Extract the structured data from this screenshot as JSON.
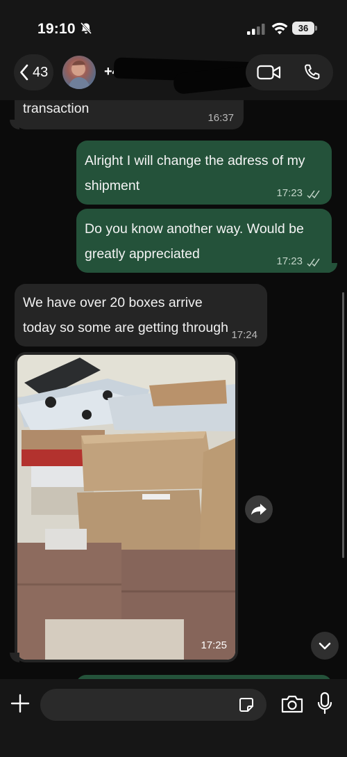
{
  "status_bar": {
    "time": "19:10",
    "battery": "36"
  },
  "header": {
    "back_count": "43",
    "contact_name": "+4"
  },
  "messages": [
    {
      "direction": "in",
      "text": "transaction",
      "time": "16:37"
    },
    {
      "direction": "out",
      "text": "Alright I will change the adress of my shipment",
      "time": "17:23",
      "read": true
    },
    {
      "direction": "out",
      "text": "Do you know another way. Would be greatly appreciated",
      "time": "17:23",
      "read": true
    },
    {
      "direction": "in",
      "text": "We have over 20 boxes arrive today so some are getting through",
      "time": "17:24"
    },
    {
      "direction": "in",
      "type": "photo",
      "time": "17:25"
    }
  ],
  "composer": {
    "placeholder": ""
  },
  "icons": {
    "mute": "bell-slash-icon",
    "signal": "cellular-signal-icon",
    "wifi": "wifi-icon",
    "back": "chevron-left-icon",
    "video": "video-camera-icon",
    "phone": "phone-icon",
    "forward": "forward-arrow-icon",
    "scroll_down": "chevron-down-icon",
    "plus": "plus-icon",
    "sticker": "sticker-icon",
    "camera": "camera-icon",
    "mic": "microphone-icon"
  },
  "colors": {
    "outgoing_bubble": "#24523a",
    "incoming_bubble": "#252525",
    "background": "#0b0b0b"
  }
}
